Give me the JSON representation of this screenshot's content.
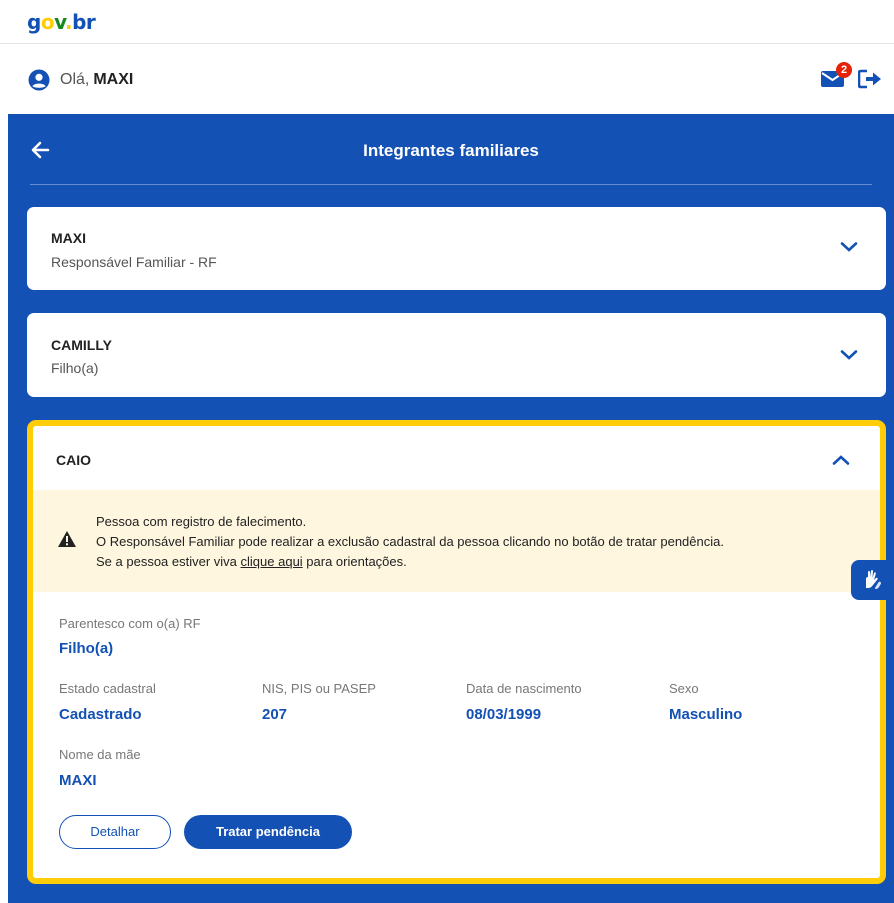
{
  "logo": {
    "g": "g",
    "o": "o",
    "v": "v",
    "b": "br"
  },
  "user": {
    "greeting": "Olá,",
    "name": "MAXI"
  },
  "notifications": {
    "count": "2"
  },
  "page": {
    "title": "Integrantes familiares"
  },
  "members": [
    {
      "name": "MAXI",
      "relation": "Responsável Familiar - RF"
    },
    {
      "name": "CAMILLY",
      "relation": "Filho(a)"
    }
  ],
  "expanded": {
    "name": "CAIO",
    "alert": {
      "line1": "Pessoa com registro de falecimento.",
      "line2": "O Responsável Familiar pode realizar a exclusão cadastral da pessoa clicando no botão de tratar pendência.",
      "line3_prefix": "Se a pessoa estiver viva ",
      "line3_link": "clique aqui",
      "line3_suffix": " para orientações."
    },
    "fields": {
      "parentesco_label": "Parentesco com o(a) RF",
      "parentesco_value": "Filho(a)",
      "estado_label": "Estado cadastral",
      "estado_value": "Cadastrado",
      "nis_label": "NIS, PIS ou PASEP",
      "nis_value": "207",
      "nascimento_label": "Data de nascimento",
      "nascimento_value": "08/03/1999",
      "sexo_label": "Sexo",
      "sexo_value": "Masculino",
      "mae_label": "Nome da mãe",
      "mae_value": "MAXI"
    },
    "buttons": {
      "detalhar": "Detalhar",
      "tratar": "Tratar pendência"
    }
  },
  "colors": {
    "primary": "#1351b4",
    "warning_bg": "#fef6df",
    "highlight_border": "#ffcd07",
    "badge": "#e52207"
  }
}
